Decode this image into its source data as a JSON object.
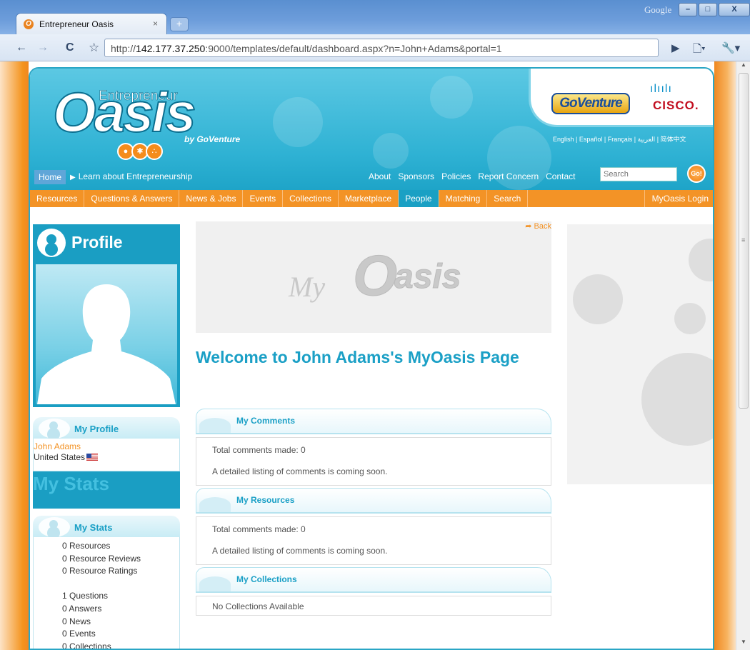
{
  "browser": {
    "tab_title": "Entrepreneur Oasis",
    "tab_close": "×",
    "new_tab": "+",
    "brand": "Google",
    "url_prefix": "http://",
    "url_host": "142.177.37.250",
    "url_rest": ":9000/templates/default/dashboard.aspx?n=John+Adams&portal=1",
    "back_icon": "←",
    "forward_icon": "→",
    "reload_icon": "C",
    "star_icon": "☆",
    "go_icon": "▶",
    "page_icon": "🗋▾",
    "tools_icon": "🔧▾",
    "minimize": "–",
    "maximize": "□",
    "close": "X"
  },
  "header": {
    "logo_main": "Oasis",
    "logo_top": "Entrepreneur",
    "logo_by": "by GoVenture",
    "goventure": "GoVenture",
    "cisco_bars": "ılıılı",
    "cisco": "CISCO.",
    "languages": "English | Español | Français | العربية | 简体中文"
  },
  "subnav": {
    "home": "Home",
    "learn": "Learn about Entrepreneurship",
    "links": [
      "About",
      "Sponsors",
      "Policies",
      "Report Concern",
      "Contact"
    ],
    "search_placeholder": "Search",
    "go": "Go!"
  },
  "mainnav": {
    "items": [
      "Resources",
      "Questions & Answers",
      "News & Jobs",
      "Events",
      "Collections",
      "Marketplace",
      "People",
      "Matching",
      "Search"
    ],
    "active": "People",
    "login": "MyOasis Login"
  },
  "sidebar": {
    "profile_title": "Profile",
    "my_profile_title": "My Profile",
    "name": "John Adams",
    "country": "United States",
    "my_stats_banner": "My Stats",
    "my_stats_title": "My Stats",
    "stats": [
      "0 Resources",
      "0 Resource Reviews",
      "0 Resource Ratings",
      "",
      "1 Questions",
      "0 Answers",
      "0 News",
      "0 Events",
      "0 Collections"
    ]
  },
  "main": {
    "back": "Back",
    "banner_my": "My",
    "banner_o": "O",
    "banner_rest": "asis",
    "welcome": "Welcome to John Adams's MyOasis Page",
    "comments_title": "My Comments",
    "comments_total": "Total comments made: 0",
    "comments_note": "A detailed listing of comments is coming soon.",
    "resources_title": "My Resources",
    "resources_total": "Total comments made: 0",
    "resources_note": "A detailed listing of comments is coming soon.",
    "collections_title": "My Collections",
    "collections_note": "No Collections Available"
  },
  "colors": {
    "accent_blue": "#1ba0c6",
    "accent_orange": "#f39326"
  }
}
